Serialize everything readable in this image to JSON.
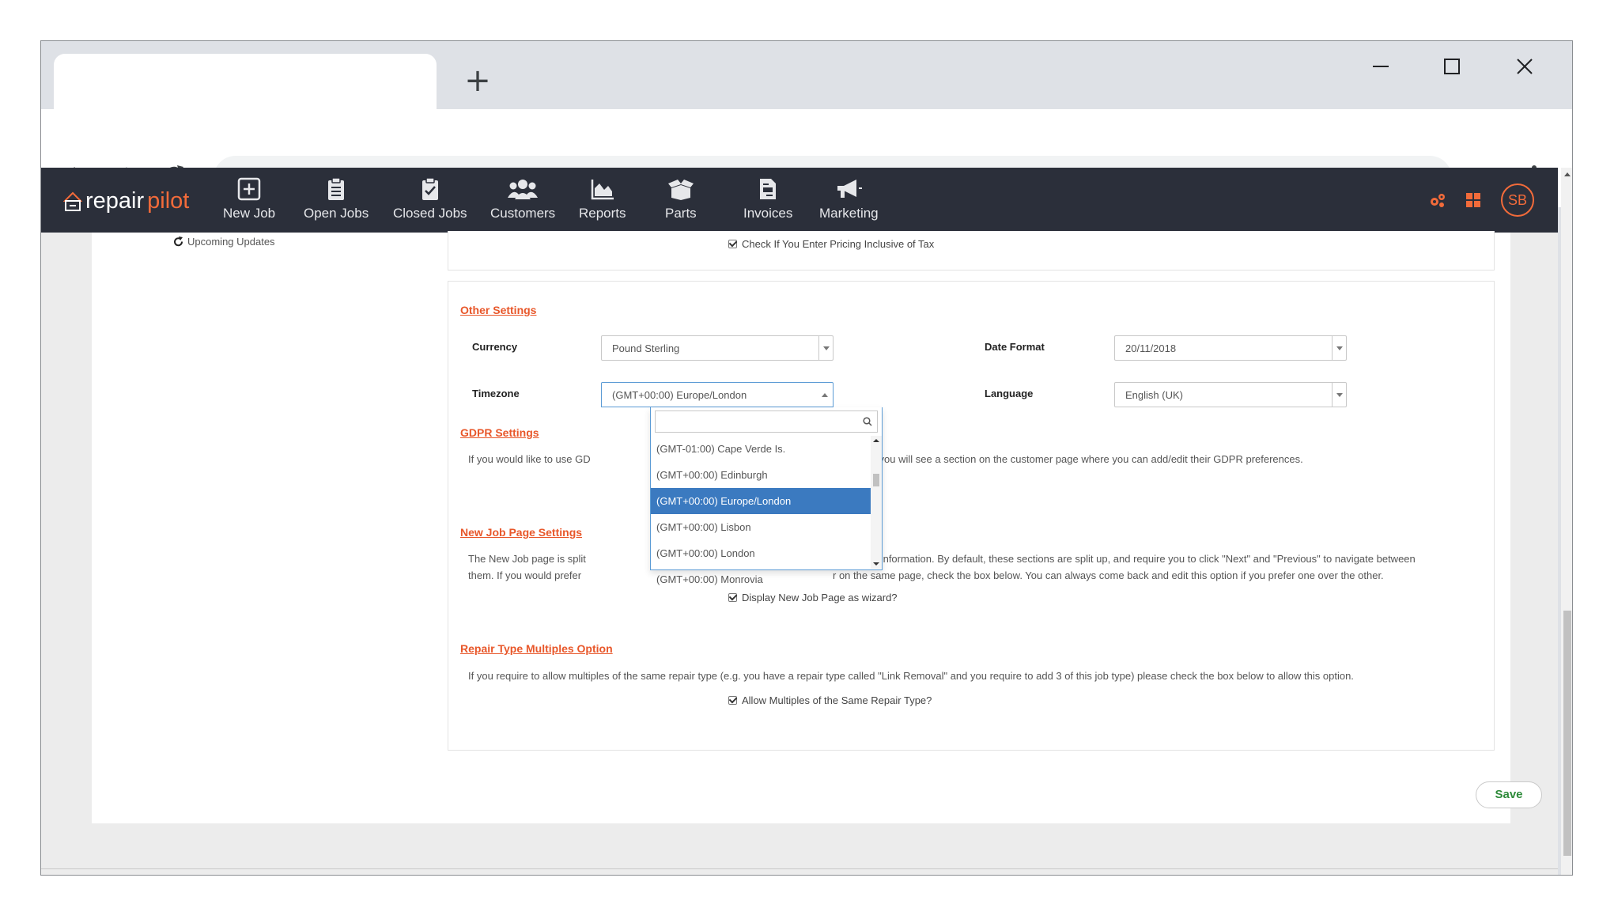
{
  "browser": {
    "new_tab_symbol": "+",
    "address": ""
  },
  "app": {
    "brand_part1": "repair",
    "brand_part2": "pilot",
    "nav": [
      {
        "label": "New Job",
        "icon": "plus-square-icon"
      },
      {
        "label": "Open Jobs",
        "icon": "clipboard-list-icon"
      },
      {
        "label": "Closed Jobs",
        "icon": "clipboard-check-icon"
      },
      {
        "label": "Customers",
        "icon": "users-icon"
      },
      {
        "label": "Reports",
        "icon": "area-chart-icon"
      },
      {
        "label": "Parts",
        "icon": "box-open-icon"
      },
      {
        "label": "Invoices",
        "icon": "file-invoice-icon"
      },
      {
        "label": "Marketing",
        "icon": "bullhorn-icon"
      }
    ],
    "avatar_initials": "SB",
    "accent_color": "#f26b3a"
  },
  "sidebar": {
    "upcoming_updates": "Upcoming Updates"
  },
  "tax": {
    "inclusive_label": "Check If You Enter Pricing Inclusive of Tax"
  },
  "other_settings": {
    "heading": "Other Settings",
    "currency_label": "Currency",
    "currency_value": "Pound Sterling",
    "date_format_label": "Date Format",
    "date_format_value": "20/11/2018",
    "timezone_label": "Timezone",
    "timezone_value": "(GMT+00:00) Europe/London",
    "language_label": "Language",
    "language_value": "English (UK)"
  },
  "timezone_dropdown": {
    "search_value": "",
    "options": [
      "(GMT-01:00) Cape Verde Is.",
      "(GMT+00:00) Edinburgh",
      "(GMT+00:00) Europe/London",
      "(GMT+00:00) Lisbon",
      "(GMT+00:00) London",
      "(GMT+00:00) Monrovia"
    ],
    "selected": "(GMT+00:00) Europe/London"
  },
  "gdpr": {
    "heading": "GDPR Settings",
    "text_before": "If you would like to use GD",
    "text_after": "elow, and you will see a section on the customer page where you can add/edit their GDPR preferences."
  },
  "new_job_page": {
    "heading": "New Job Page Settings",
    "line1_before": "The New Job page is split",
    "line1_after": "nd Repair Information. By default, these sections are split up, and require you to click \"Next\" and \"Previous\" to navigate between",
    "line2_before": "them. If you would prefer",
    "line2_after": "r on the same page, check the box below. You can always come back and edit this option if you prefer one over the other.",
    "checkbox_label": "Display New Job Page as wizard?"
  },
  "repair_multiples": {
    "heading": "Repair Type Multiples Option",
    "text": "If you require to allow multiples of the same repair type (e.g. you have a repair type called \"Link Removal\" and you require to add 3 of this job type) please check the box below to allow this option.",
    "checkbox_label": "Allow Multiples of the Same Repair Type?"
  },
  "save_label": "Save"
}
